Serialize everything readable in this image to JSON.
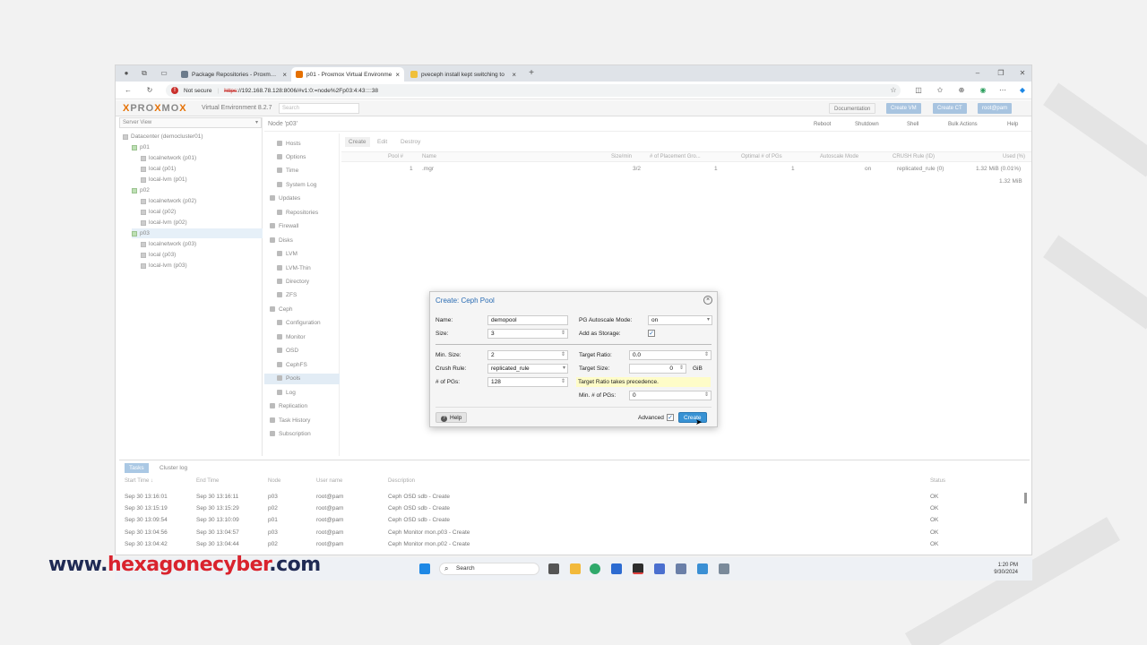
{
  "browser": {
    "tabs": [
      {
        "title": "Package Repositories - Proxmox V",
        "color": "#6b7b8b"
      },
      {
        "title": "p01 - Proxmox Virtual Environme",
        "color": "#e57000"
      },
      {
        "title": "pveceph install kept switching to",
        "color": "#f0c03a"
      }
    ],
    "not_secure": "Not secure",
    "url_scheme": "https",
    "url_rest": "://192.168.78.128:8006/#v1:0:=node%2Fp03:4:43::::38"
  },
  "pve": {
    "logo_a": "PRO",
    "logo_x": "X",
    "logo_b": "MO",
    "logo_x2": "X",
    "version": "Virtual Environment 8.2.7",
    "search_placeholder": "Search",
    "documentation": "Documentation",
    "create_vm": "Create VM",
    "create_ct": "Create CT",
    "user": "root@pam"
  },
  "tree": {
    "view": "Server View",
    "datacenter": "Datacenter (democluster01)",
    "nodes": [
      {
        "name": "p01",
        "children": [
          "localnetwork (p01)",
          "local (p01)",
          "local-lvm (p01)"
        ]
      },
      {
        "name": "p02",
        "children": [
          "localnetwork (p02)",
          "local (p02)",
          "local-lvm (p02)"
        ]
      },
      {
        "name": "p03",
        "children": [
          "localnetwork (p03)",
          "local (p03)",
          "local-lvm (p03)"
        ]
      }
    ]
  },
  "node_header": {
    "title": "Node 'p03'",
    "reboot": "Reboot",
    "shutdown": "Shutdown",
    "shell": "Shell",
    "bulk": "Bulk Actions",
    "help": "Help"
  },
  "menu": [
    "Hosts",
    "Options",
    "Time",
    "System Log",
    "Updates",
    "Repositories",
    "Firewall",
    "Disks",
    "LVM",
    "LVM-Thin",
    "Directory",
    "ZFS",
    "Ceph",
    "Configuration",
    "Monitor",
    "OSD",
    "CephFS",
    "Pools",
    "Log",
    "Replication",
    "Task History",
    "Subscription"
  ],
  "pools": {
    "create": "Create",
    "edit": "Edit",
    "destroy": "Destroy",
    "headers": [
      "Pool #",
      "Name",
      "Size/min",
      "# of Placement Gro...",
      "Optimal # of PGs",
      "Autoscale Mode",
      "CRUSH Rule (ID)",
      "Used (%)"
    ],
    "row": [
      "1",
      ".mgr",
      "3/2",
      "1",
      "1",
      "on",
      "replicated_rule (0)",
      "1.32 MiB (0.01%)"
    ],
    "total": "1.32 MiB"
  },
  "tasks": {
    "tab_tasks": "Tasks",
    "tab_log": "Cluster log",
    "headers": [
      "Start Time ↓",
      "End Time",
      "Node",
      "User name",
      "Description",
      "Status"
    ],
    "rows": [
      [
        "Sep 30 13:16:01",
        "Sep 30 13:16:11",
        "p03",
        "root@pam",
        "Ceph OSD sdb - Create",
        "OK"
      ],
      [
        "Sep 30 13:15:19",
        "Sep 30 13:15:29",
        "p02",
        "root@pam",
        "Ceph OSD sdb - Create",
        "OK"
      ],
      [
        "Sep 30 13:09:54",
        "Sep 30 13:10:09",
        "p01",
        "root@pam",
        "Ceph OSD sdb - Create",
        "OK"
      ],
      [
        "Sep 30 13:04:56",
        "Sep 30 13:04:57",
        "p03",
        "root@pam",
        "Ceph Monitor mon.p03 - Create",
        "OK"
      ],
      [
        "Sep 30 13:04:42",
        "Sep 30 13:04:44",
        "p02",
        "root@pam",
        "Ceph Monitor mon.p02 - Create",
        "OK"
      ]
    ]
  },
  "dialog": {
    "title": "Create: Ceph Pool",
    "name_label": "Name:",
    "name_value": "demopool",
    "size_label": "Size:",
    "size_value": "3",
    "pg_mode_label": "PG Autoscale Mode:",
    "pg_mode_value": "on",
    "add_storage_label": "Add as Storage:",
    "minsize_label": "Min. Size:",
    "minsize_value": "2",
    "crush_label": "Crush Rule:",
    "crush_value": "replicated_rule",
    "pgs_label": "# of PGs:",
    "pgs_value": "128",
    "target_ratio_label": "Target Ratio:",
    "target_ratio_value": "0.0",
    "target_size_label": "Target Size:",
    "target_size_value": "0",
    "target_size_unit": "GiB",
    "warning": "Target Ratio takes precedence.",
    "min_pgs_label": "Min. # of PGs:",
    "min_pgs_value": "0",
    "help": "Help",
    "advanced": "Advanced",
    "create": "Create"
  },
  "taskbar": {
    "search": "Search",
    "time": "1:20 PM",
    "date": "9/30/2024"
  },
  "watermark": {
    "prefix": "www.",
    "brand": "hexagonecyber",
    "suffix": ".com"
  }
}
